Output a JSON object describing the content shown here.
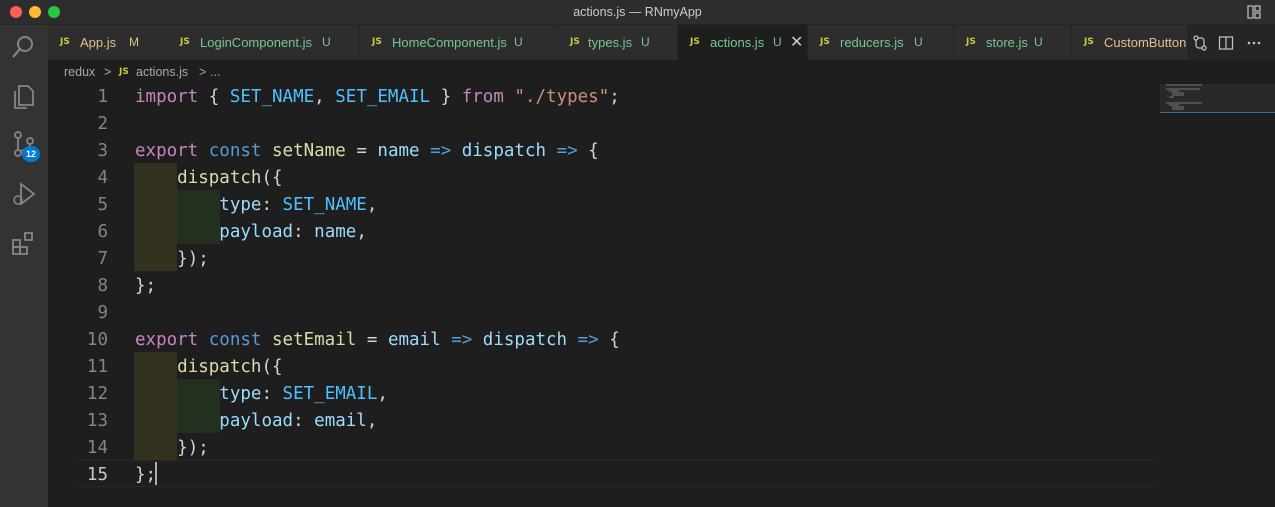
{
  "window": {
    "title": "actions.js — RNmyApp"
  },
  "activity_bar": {
    "scm_badge": "12"
  },
  "tabs": [
    {
      "label": "App.js",
      "status": "M",
      "active": false
    },
    {
      "label": "LoginComponent.js",
      "status": "U",
      "active": false
    },
    {
      "label": "HomeComponent.js",
      "status": "U",
      "active": false
    },
    {
      "label": "types.js",
      "status": "U",
      "active": false
    },
    {
      "label": "actions.js",
      "status": "U",
      "active": true
    },
    {
      "label": "reducers.js",
      "status": "U",
      "active": false
    },
    {
      "label": "store.js",
      "status": "U",
      "active": false
    },
    {
      "label": "CustomButton",
      "status": "",
      "active": false
    }
  ],
  "file_icon": "JS",
  "close_glyph": "✕",
  "breadcrumb": {
    "folder": "redux",
    "sep1": ">",
    "file": "actions.js",
    "sep2": ">",
    "more": "..."
  },
  "editor": {
    "current_line": 15,
    "lines": [
      {
        "n": "1",
        "t": "import { SET_NAME, SET_EMAIL } from \"./types\";"
      },
      {
        "n": "2",
        "t": ""
      },
      {
        "n": "3",
        "t": "export const setName = name => dispatch => {"
      },
      {
        "n": "4",
        "t": "    dispatch({"
      },
      {
        "n": "5",
        "t": "        type: SET_NAME,"
      },
      {
        "n": "6",
        "t": "        payload: name,"
      },
      {
        "n": "7",
        "t": "    });"
      },
      {
        "n": "8",
        "t": "};"
      },
      {
        "n": "9",
        "t": ""
      },
      {
        "n": "10",
        "t": "export const setEmail = email => dispatch => {"
      },
      {
        "n": "11",
        "t": "    dispatch({"
      },
      {
        "n": "12",
        "t": "        type: SET_EMAIL,"
      },
      {
        "n": "13",
        "t": "        payload: email,"
      },
      {
        "n": "14",
        "t": "    });"
      },
      {
        "n": "15",
        "t": "};"
      }
    ]
  },
  "colors": {
    "keyword": "#c586c0",
    "storage": "#569cd6",
    "function": "#dcdcaa",
    "variable": "#9cdcfe",
    "constant": "#4fc1ff",
    "string": "#ce9178",
    "modified": "#e2c08d",
    "untracked": "#73c991",
    "badge": "#0078d4"
  },
  "icons": [
    "search-icon",
    "files-icon",
    "source-control-icon",
    "run-debug-icon",
    "extensions-icon",
    "compare-changes-icon",
    "split-editor-icon",
    "more-actions-icon",
    "layout-icon"
  ]
}
